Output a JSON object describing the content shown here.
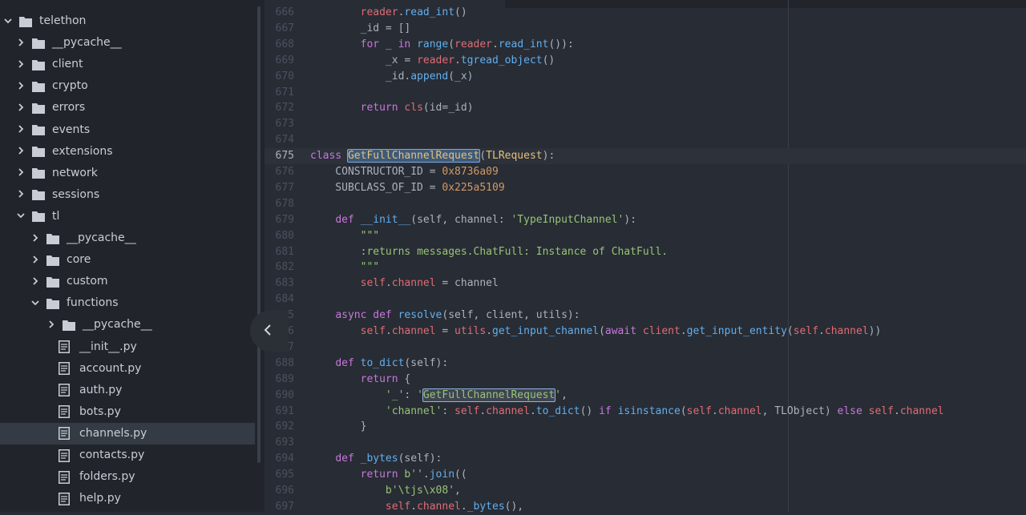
{
  "tree": {
    "items": [
      {
        "label": "telethon",
        "depth": 0,
        "type": "folder",
        "expanded": true
      },
      {
        "label": "__pycache__",
        "depth": 1,
        "type": "folder",
        "expanded": false
      },
      {
        "label": "client",
        "depth": 1,
        "type": "folder",
        "expanded": false
      },
      {
        "label": "crypto",
        "depth": 1,
        "type": "folder",
        "expanded": false
      },
      {
        "label": "errors",
        "depth": 1,
        "type": "folder",
        "expanded": false
      },
      {
        "label": "events",
        "depth": 1,
        "type": "folder",
        "expanded": false
      },
      {
        "label": "extensions",
        "depth": 1,
        "type": "folder",
        "expanded": false
      },
      {
        "label": "network",
        "depth": 1,
        "type": "folder",
        "expanded": false
      },
      {
        "label": "sessions",
        "depth": 1,
        "type": "folder",
        "expanded": false
      },
      {
        "label": "tl",
        "depth": 1,
        "type": "folder",
        "expanded": true
      },
      {
        "label": "__pycache__",
        "depth": 2,
        "type": "folder",
        "expanded": false
      },
      {
        "label": "core",
        "depth": 2,
        "type": "folder",
        "expanded": false
      },
      {
        "label": "custom",
        "depth": 2,
        "type": "folder",
        "expanded": false
      },
      {
        "label": "functions",
        "depth": 2,
        "type": "folder",
        "expanded": true
      },
      {
        "label": "__pycache__",
        "depth": 3,
        "type": "folder",
        "expanded": false
      },
      {
        "label": "__init__.py",
        "depth": 3,
        "type": "file"
      },
      {
        "label": "account.py",
        "depth": 3,
        "type": "file"
      },
      {
        "label": "auth.py",
        "depth": 3,
        "type": "file"
      },
      {
        "label": "bots.py",
        "depth": 3,
        "type": "file"
      },
      {
        "label": "channels.py",
        "depth": 3,
        "type": "file",
        "selected": true
      },
      {
        "label": "contacts.py",
        "depth": 3,
        "type": "file"
      },
      {
        "label": "folders.py",
        "depth": 3,
        "type": "file"
      },
      {
        "label": "help.py",
        "depth": 3,
        "type": "file"
      }
    ]
  },
  "editor": {
    "cursor_line": "675",
    "lines": [
      {
        "n": "666",
        "t": [
          [
            "        ",
            ""
          ],
          [
            "reader",
            "v"
          ],
          [
            ".",
            ""
          ],
          [
            "read_int",
            "f"
          ],
          [
            "()",
            ""
          ]
        ]
      },
      {
        "n": "667",
        "t": [
          [
            "        _id = []",
            ""
          ]
        ]
      },
      {
        "n": "668",
        "t": [
          [
            "        ",
            ""
          ],
          [
            "for",
            "k"
          ],
          [
            " _ ",
            ""
          ],
          [
            "in",
            "k"
          ],
          [
            " ",
            ""
          ],
          [
            "range",
            "f"
          ],
          [
            "(",
            ""
          ],
          [
            "reader",
            "v"
          ],
          [
            ".",
            ""
          ],
          [
            "read_int",
            "f"
          ],
          [
            "()):",
            ""
          ]
        ]
      },
      {
        "n": "669",
        "t": [
          [
            "            _x = ",
            ""
          ],
          [
            "reader",
            "v"
          ],
          [
            ".",
            ""
          ],
          [
            "tgread_object",
            "f"
          ],
          [
            "()",
            ""
          ]
        ]
      },
      {
        "n": "670",
        "t": [
          [
            "            _id.",
            ""
          ],
          [
            "append",
            "f"
          ],
          [
            "(_x)",
            ""
          ]
        ]
      },
      {
        "n": "671",
        "t": [
          [
            "",
            ""
          ]
        ]
      },
      {
        "n": "672",
        "t": [
          [
            "        ",
            ""
          ],
          [
            "return",
            "k"
          ],
          [
            " ",
            ""
          ],
          [
            "cls",
            "v"
          ],
          [
            "(id=_id)",
            ""
          ]
        ]
      },
      {
        "n": "673",
        "t": [
          [
            "",
            ""
          ]
        ]
      },
      {
        "n": "674",
        "t": [
          [
            "",
            ""
          ]
        ]
      },
      {
        "n": "675",
        "t": [
          [
            "class",
            "k"
          ],
          [
            " ",
            ""
          ],
          [
            "GetFullChannelRequest",
            "c",
            "sel"
          ],
          [
            "(",
            ""
          ],
          [
            "TLRequest",
            "c"
          ],
          [
            "):",
            ""
          ]
        ]
      },
      {
        "n": "676",
        "t": [
          [
            "    CONSTRUCTOR_ID = ",
            ""
          ],
          [
            "0x8736a09",
            "n"
          ]
        ]
      },
      {
        "n": "677",
        "t": [
          [
            "    SUBCLASS_OF_ID = ",
            ""
          ],
          [
            "0x225a5109",
            "n"
          ]
        ]
      },
      {
        "n": "678",
        "t": [
          [
            "",
            ""
          ]
        ]
      },
      {
        "n": "679",
        "t": [
          [
            "    ",
            ""
          ],
          [
            "def",
            "k"
          ],
          [
            " ",
            ""
          ],
          [
            "__init__",
            "f"
          ],
          [
            "(self, channel: ",
            ""
          ],
          [
            "'TypeInputChannel'",
            "s"
          ],
          [
            "):",
            ""
          ]
        ]
      },
      {
        "n": "680",
        "t": [
          [
            "        ",
            ""
          ],
          [
            "\"\"\"",
            "s"
          ]
        ]
      },
      {
        "n": "681",
        "t": [
          [
            "        ",
            ""
          ],
          [
            ":returns messages.ChatFull: Instance of ChatFull.",
            "s"
          ]
        ]
      },
      {
        "n": "682",
        "t": [
          [
            "        ",
            ""
          ],
          [
            "\"\"\"",
            "s"
          ]
        ]
      },
      {
        "n": "683",
        "t": [
          [
            "        ",
            ""
          ],
          [
            "self",
            "v"
          ],
          [
            ".",
            ""
          ],
          [
            "channel",
            "v"
          ],
          [
            " = channel",
            ""
          ]
        ]
      },
      {
        "n": "684",
        "t": [
          [
            "",
            ""
          ]
        ]
      },
      {
        "n": "685",
        "t": [
          [
            "    ",
            ""
          ],
          [
            "async",
            "k"
          ],
          [
            " ",
            ""
          ],
          [
            "def",
            "k"
          ],
          [
            " ",
            ""
          ],
          [
            "resolve",
            "f"
          ],
          [
            "(self, client, utils):",
            ""
          ]
        ]
      },
      {
        "n": "686",
        "t": [
          [
            "        ",
            ""
          ],
          [
            "self",
            "v"
          ],
          [
            ".",
            ""
          ],
          [
            "channel",
            "v"
          ],
          [
            " = ",
            ""
          ],
          [
            "utils",
            "v"
          ],
          [
            ".",
            ""
          ],
          [
            "get_input_channel",
            "f"
          ],
          [
            "(",
            ""
          ],
          [
            "await",
            "k"
          ],
          [
            " ",
            ""
          ],
          [
            "client",
            "v"
          ],
          [
            ".",
            ""
          ],
          [
            "get_input_entity",
            "f"
          ],
          [
            "(",
            ""
          ],
          [
            "self",
            "v"
          ],
          [
            ".",
            ""
          ],
          [
            "channel",
            "v"
          ],
          [
            "))",
            ""
          ]
        ]
      },
      {
        "n": "687",
        "t": [
          [
            "",
            ""
          ]
        ]
      },
      {
        "n": "688",
        "t": [
          [
            "    ",
            ""
          ],
          [
            "def",
            "k"
          ],
          [
            " ",
            ""
          ],
          [
            "to_dict",
            "f"
          ],
          [
            "(self):",
            ""
          ]
        ]
      },
      {
        "n": "689",
        "t": [
          [
            "        ",
            ""
          ],
          [
            "return",
            "k"
          ],
          [
            " {",
            ""
          ]
        ]
      },
      {
        "n": "690",
        "t": [
          [
            "            ",
            ""
          ],
          [
            "'_'",
            "s"
          ],
          [
            ": ",
            ""
          ],
          [
            "'",
            "s"
          ],
          [
            "GetFullChannelRequest",
            "s",
            "hl"
          ],
          [
            "'",
            "s"
          ],
          [
            ",",
            ""
          ]
        ]
      },
      {
        "n": "691",
        "t": [
          [
            "            ",
            ""
          ],
          [
            "'channel'",
            "s"
          ],
          [
            ": ",
            ""
          ],
          [
            "self",
            "v"
          ],
          [
            ".",
            ""
          ],
          [
            "channel",
            "v"
          ],
          [
            ".",
            ""
          ],
          [
            "to_dict",
            "f"
          ],
          [
            "() ",
            ""
          ],
          [
            "if",
            "k"
          ],
          [
            " ",
            ""
          ],
          [
            "isinstance",
            "f"
          ],
          [
            "(",
            ""
          ],
          [
            "self",
            "v"
          ],
          [
            ".",
            ""
          ],
          [
            "channel",
            "v"
          ],
          [
            ", TLObject) ",
            ""
          ],
          [
            "else",
            "k"
          ],
          [
            " ",
            ""
          ],
          [
            "self",
            "v"
          ],
          [
            ".",
            ""
          ],
          [
            "channel",
            "v"
          ]
        ]
      },
      {
        "n": "692",
        "t": [
          [
            "        }",
            ""
          ]
        ]
      },
      {
        "n": "693",
        "t": [
          [
            "",
            ""
          ]
        ]
      },
      {
        "n": "694",
        "t": [
          [
            "    ",
            ""
          ],
          [
            "def",
            "k"
          ],
          [
            " ",
            ""
          ],
          [
            "_bytes",
            "f"
          ],
          [
            "(self):",
            ""
          ]
        ]
      },
      {
        "n": "695",
        "t": [
          [
            "        ",
            ""
          ],
          [
            "return",
            "k"
          ],
          [
            " ",
            ""
          ],
          [
            "b''",
            "s"
          ],
          [
            ".",
            ""
          ],
          [
            "join",
            "f"
          ],
          [
            "((",
            ""
          ]
        ]
      },
      {
        "n": "696",
        "t": [
          [
            "            ",
            ""
          ],
          [
            "b'\\tjs\\x08'",
            "s"
          ],
          [
            ",",
            ""
          ]
        ]
      },
      {
        "n": "697",
        "t": [
          [
            "            ",
            ""
          ],
          [
            "self",
            "v"
          ],
          [
            ".",
            ""
          ],
          [
            "channel",
            "v"
          ],
          [
            ".",
            ""
          ],
          [
            "_bytes",
            "f"
          ],
          [
            "(),",
            ""
          ]
        ]
      }
    ]
  },
  "colors": {
    "k": "#c678dd",
    "f": "#61afef",
    "s": "#98c379",
    "n": "#d19a66",
    "v": "#e06c75",
    "c": "#e5c07b",
    "p": "#abb2bf"
  },
  "icons": {
    "folder": "folder-icon",
    "file": "file-icon",
    "expanded": "chevron-down-icon",
    "collapsed": "chevron-right-icon",
    "collapse_panel": "chevron-left-icon"
  }
}
